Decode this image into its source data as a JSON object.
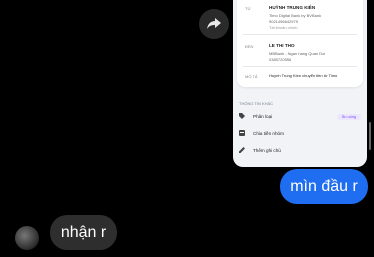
{
  "forward": {
    "icon": "share-arrow-icon"
  },
  "card": {
    "from_label": "TỪ",
    "from_name": "HUỲNH TRUNG KIÊN",
    "from_bank": "Timo Digital Bank by BVBank",
    "from_account": "9021496642979",
    "from_tag": "Tài khoản chính",
    "to_label": "ĐẾN",
    "to_name": "LE THI THO",
    "to_bank": "MBBank - Ngan hang Quan Doi",
    "to_account": "0385720556",
    "desc_label": "MÔ TẢ",
    "desc_value": "Huynh Trung Kien chuyển tiền từ Timo",
    "section_title": "THÔNG TIN KHÁC",
    "options": [
      {
        "label": "Phân loại",
        "icon": "tag-icon"
      },
      {
        "label": "Chia tiền nhóm",
        "icon": "split-bill-icon"
      },
      {
        "label": "Thêm ghi chú",
        "icon": "pencil-icon"
      }
    ],
    "category_pill": "Ăn uống"
  },
  "messages": {
    "sent": "mìn đầu r",
    "received": "nhận r"
  },
  "colors": {
    "sent_bubble": "#1f6df0",
    "received_bubble": "#2e2e2e",
    "background": "#000000"
  }
}
